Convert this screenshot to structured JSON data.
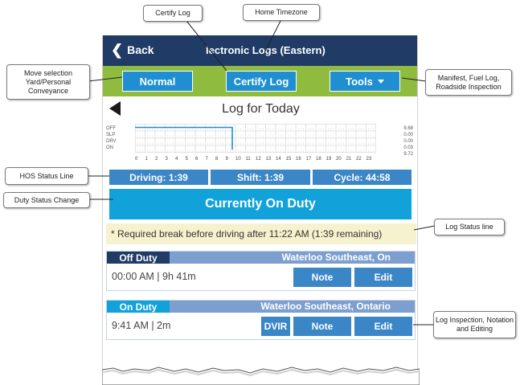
{
  "app": {
    "back_label": "Back",
    "title": "lectronic Logs (Eastern)"
  },
  "toolbar": {
    "normal_label": "Normal",
    "certify_label": "Certify Log",
    "tools_label": "Tools"
  },
  "log": {
    "title": "Log for Today",
    "status_labels": [
      "OFF",
      "SLP",
      "DRV",
      "ON"
    ],
    "status_values": [
      "9.68",
      "0.00",
      "0.00",
      "0.03",
      "9.72"
    ],
    "hours": [
      "0",
      "1",
      "2",
      "3",
      "4",
      "5",
      "6",
      "7",
      "8",
      "9",
      "10",
      "11",
      "12",
      "13",
      "14",
      "15",
      "16",
      "17",
      "18",
      "19",
      "20",
      "21",
      "22",
      "23"
    ],
    "segments": [
      {
        "status": "OFF",
        "start_hour": 0.0,
        "end_hour": 9.68
      },
      {
        "status": "ON",
        "start_hour": 9.68,
        "end_hour": 9.72
      }
    ]
  },
  "hos": {
    "driving": "Driving: 1:39",
    "shift": "Shift: 1:39",
    "cycle": "Cycle: 44:58"
  },
  "duty_status": "Currently On Duty",
  "status_line": "* Required break before driving after 11:22 AM (1:39 remaining)",
  "entries": [
    {
      "status": "Off Duty",
      "location": "Waterloo Southeast,  On",
      "time": "00:00 AM | 9h 41m",
      "buttons": [
        "Note",
        "Edit"
      ],
      "status_color": "#1f3b66"
    },
    {
      "status": "On Duty",
      "location": "Waterloo Southeast,  Ontario",
      "time": "9:41 AM | 2m",
      "buttons": [
        "DVIR",
        "Note",
        "Edit"
      ],
      "status_color": "#11a2d9"
    }
  ],
  "callouts": {
    "certify_log": "Certify Log",
    "home_timezone": "Home Timezone",
    "move_selection": "Move selection Yard/Personal Conveyance",
    "manifest": "Manifest, Fuel Log, Roadside Inspection",
    "hos_status_line": "HOS Status Line",
    "duty_status_change": "Duty Status Change",
    "log_status_line": "Log Status line",
    "log_inspection": "Log Inspection, Notation and Editing"
  },
  "colors": {
    "titlebar": "#1f3b66",
    "toolbar": "#8fbc3f",
    "button": "#1f8fd1",
    "duty_banner": "#11a2d9",
    "graph_line": "#1f8fd1"
  }
}
